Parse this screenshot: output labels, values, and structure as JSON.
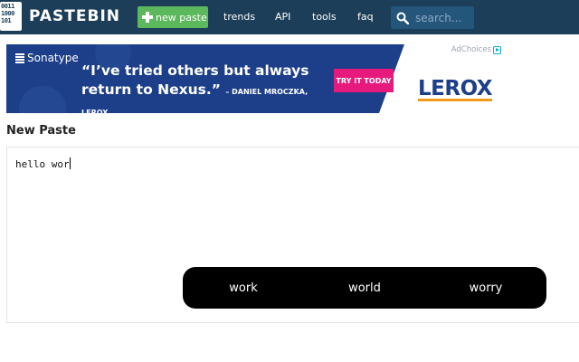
{
  "header": {
    "logo_icon_text": [
      "0011",
      "1000",
      "101"
    ],
    "logo_text": "PASTEBIN",
    "new_paste_label": "new paste",
    "nav": [
      "trends",
      "API",
      "tools",
      "faq"
    ],
    "search_placeholder": "search...",
    "background_color": "#1c3e58",
    "button_color": "#5cb85c"
  },
  "ad": {
    "brand": "Sonatype",
    "quote": "“I’ve tried others but always return to Nexus.”",
    "attribution": "– DANIEL MROCZKA, LEROX",
    "cta": "TRY IT TODAY",
    "partner_logo": "LEROX",
    "adchoices": "AdChoices",
    "background_color": "#1d3f8a",
    "cta_color": "#e6197c"
  },
  "paste": {
    "title": "New Paste",
    "content": "hello wor"
  },
  "suggestions": [
    "work",
    "world",
    "worry"
  ]
}
